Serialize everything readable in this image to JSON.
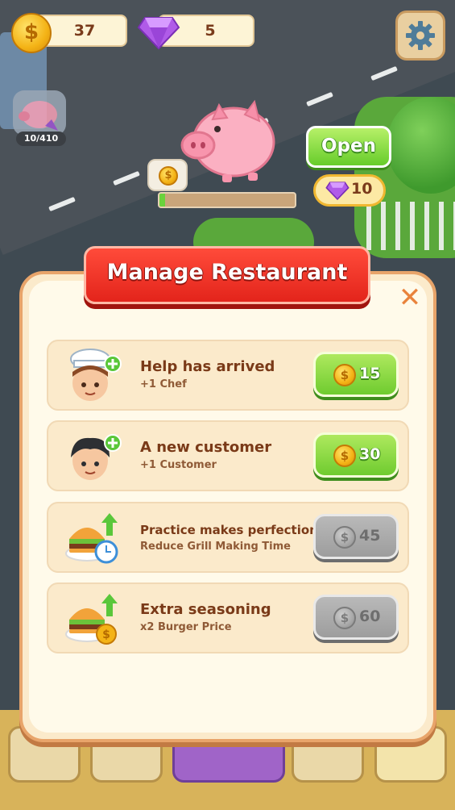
{
  "hud": {
    "coins": "37",
    "gems": "5",
    "coin_icon": "dollar-coin-icon",
    "gem_icon": "purple-gem-icon",
    "settings_icon": "gear-icon"
  },
  "piggy_bank": {
    "count": "10/410",
    "progress": 0.04,
    "open_label": "Open",
    "open_cost": "10"
  },
  "dialog": {
    "title": "Manage Restaurant",
    "close_icon": "close-icon",
    "upgrades": [
      {
        "title": "Help has arrived",
        "subtitle": "+1 Chef",
        "price": "15",
        "enabled": true,
        "icon": "chef-avatar-icon"
      },
      {
        "title": "A new customer",
        "subtitle": "+1 Customer",
        "price": "30",
        "enabled": true,
        "icon": "customer-avatar-icon"
      },
      {
        "title": "Practice makes perfection",
        "subtitle": "Reduce Grill Making Time",
        "price": "45",
        "enabled": false,
        "icon": "burger-timer-icon"
      },
      {
        "title": "Extra seasoning",
        "subtitle": "x2 Burger Price",
        "price": "60",
        "enabled": false,
        "icon": "burger-coin-icon"
      }
    ]
  },
  "colors": {
    "banner_red": "#e3241b",
    "button_green": "#6fcb2f",
    "button_grey": "#9d9d9d",
    "panel_cream": "#fffaea",
    "text_brown": "#7a3a18"
  }
}
